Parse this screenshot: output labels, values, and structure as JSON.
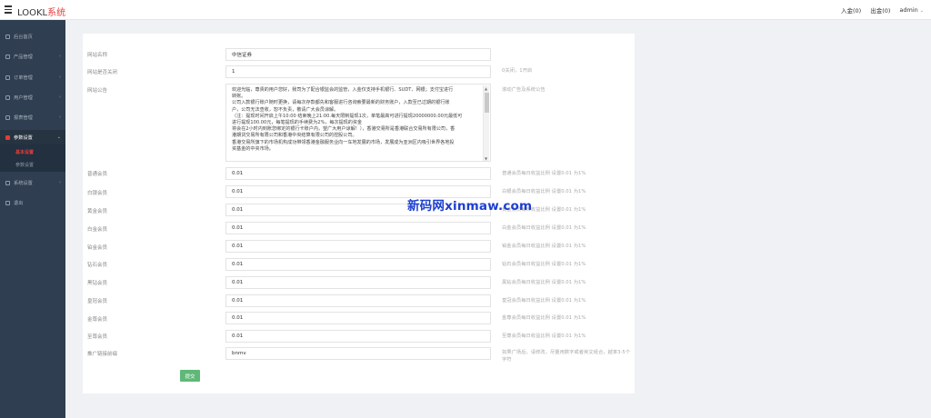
{
  "header": {
    "brand_a": "LOOKL",
    "brand_b": "系统",
    "deposit": "入金(0)",
    "withdraw": "出金(0)",
    "user": "admin"
  },
  "sidebar": {
    "items": [
      {
        "label": "后台首页",
        "icon": "home-icon"
      },
      {
        "label": "产品管理",
        "icon": "product-icon"
      },
      {
        "label": "订单管理",
        "icon": "order-icon"
      },
      {
        "label": "用户管理",
        "icon": "user-icon"
      },
      {
        "label": "报表管理",
        "icon": "report-icon"
      },
      {
        "label": "参数设置",
        "icon": "settings-icon"
      },
      {
        "label": "系统设置",
        "icon": "gear-icon"
      },
      {
        "label": "退出",
        "icon": "logout-icon"
      }
    ],
    "sub_items": [
      "基本设置",
      "参数设置"
    ]
  },
  "form": {
    "rows": [
      {
        "label": "网站名称",
        "value": "中信证券",
        "hint": ""
      },
      {
        "label": "网站是否关闭",
        "value": "1",
        "hint": "0关闭，1开启"
      }
    ],
    "notice": {
      "label": "网站公告",
      "hint": "滚动广告及系统公告",
      "lines": [
        "欢迎光临，尊贵的用户您好，我司为了配合银监会的监管，入金仅支持手机银行、SUDT、网银；支付宝进行",
        "转账。",
        "公司入款银行账户随时更换，请每次存款都先和客服进行咨询索要最新的财务账户，入款至已过期的银行账",
        "户，公司无法查收，恕不负责，敬请广大会员谅解。",
        "（注：提现时间开启上午10:00 结束晚上21:00.每天限制提现1次，单笔最高可进行提现20000000.00元最低可",
        "进行提现100.00元，每笔提现的手续费为2%，每次提现的资金",
        "将会在2小时内到账您绑定的银行卡账户内，望广大用户谅解！），香港交易所是香港联合交易所有限公司，香",
        "港期货交易所有限公司和香港中央结算有限公司的控股公司。",
        "香港交易所旗下的市场机构成功带领香港金融服务业向一车地发展的市场，发展成为亚洲区内吸引世界各地投",
        "资基金的中央市场。"
      ]
    },
    "levels": [
      {
        "label": "普通会员",
        "value": "0.01",
        "hint": "普通会员每日收益比例 设置0.01 为1%"
      },
      {
        "label": "白银会员",
        "value": "0.01",
        "hint": "白银会员每日收益比例 设置0.01 为1%"
      },
      {
        "label": "黄金会员",
        "value": "0.01",
        "hint": "黄金会员每日收益比例 设置0.01 为1%"
      },
      {
        "label": "白金会员",
        "value": "0.01",
        "hint": "白金会员每日收益比例 设置0.01 为1%"
      },
      {
        "label": "铂金会员",
        "value": "0.01",
        "hint": "铂金会员每日收益比例 设置0.01 为1%"
      },
      {
        "label": "钻石会员",
        "value": "0.01",
        "hint": "钻石会员每日收益比例 设置0.01 为1%"
      },
      {
        "label": "黑钻会员",
        "value": "0.01",
        "hint": "黑钻会员每日收益比例 设置0.01 为1%"
      },
      {
        "label": "皇冠会员",
        "value": "0.01",
        "hint": "皇冠会员每日收益比例 设置0.01 为1%"
      },
      {
        "label": "金尊会员",
        "value": "0.01",
        "hint": "金尊会员每日收益比例 设置0.01 为1%"
      },
      {
        "label": "至尊会员",
        "value": "0.01",
        "hint": "至尊会员每日收益比例 设置0.01 为1%"
      }
    ],
    "promo": {
      "label": "推广链接前缀",
      "value": "bnmv",
      "hint": "如果广场后，请修改，尽量用数字或者英文组合，越率3-5个字符"
    },
    "submit_label": "提交"
  },
  "watermark": "新码网xinmaw.com"
}
